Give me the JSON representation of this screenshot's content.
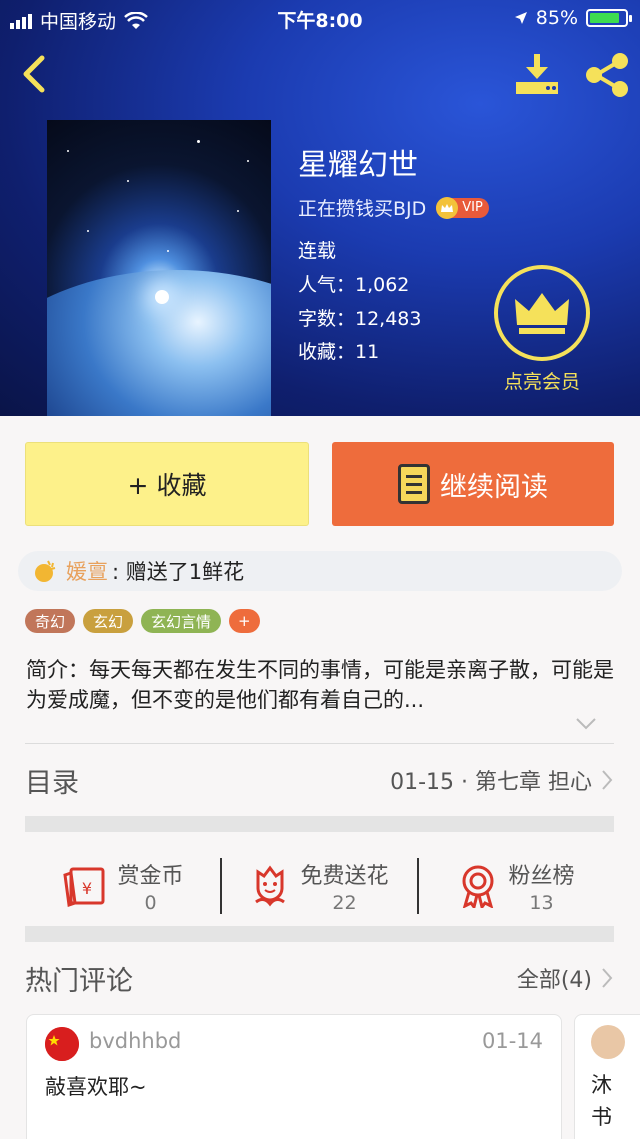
{
  "status_bar": {
    "carrier": "中国移动",
    "time": "下午8:00",
    "battery": "85%"
  },
  "book": {
    "title": "星耀幻世",
    "author": "正在攒钱买BJD",
    "vip_label": "VIP",
    "status": "连载",
    "popularity": "人气：1,062",
    "word_count": "字数：12,483",
    "favorites": "收藏：11"
  },
  "member": {
    "label": "点亮会员"
  },
  "actions": {
    "collect_label": "+ 收藏",
    "read_label": "继续阅读"
  },
  "gift": {
    "sender": "媛亶",
    "message": ": 赠送了1鲜花"
  },
  "tags": [
    {
      "label": "奇幻",
      "color": "#c1765a"
    },
    {
      "label": "玄幻",
      "color": "#c9a03e"
    },
    {
      "label": "玄幻言情",
      "color": "#8fb454"
    },
    {
      "label": "+",
      "color": "#ee6c3c"
    }
  ],
  "intro": "简介：每天每天都在发生不同的事情，可能是亲离子散，可能是为爱成魔，但不变的是他们都有着自己的...",
  "toc": {
    "title": "目录",
    "latest": "01-15 · 第七章  担心"
  },
  "stats": [
    {
      "label": "赏金币",
      "value": "0"
    },
    {
      "label": "免费送花",
      "value": "22"
    },
    {
      "label": "粉丝榜",
      "value": "13"
    }
  ],
  "comments_section": {
    "title": "热门评论",
    "all_label": "全部(4)"
  },
  "comments": [
    {
      "user": "bvdhhbd",
      "date": "01-14",
      "text": "敲喜欢耶~"
    },
    {
      "text": "沐书"
    }
  ],
  "colors": {
    "accent_orange": "#ee6c3c",
    "collect_yellow": "#fdf18a",
    "member_gold": "#f5e15a"
  }
}
